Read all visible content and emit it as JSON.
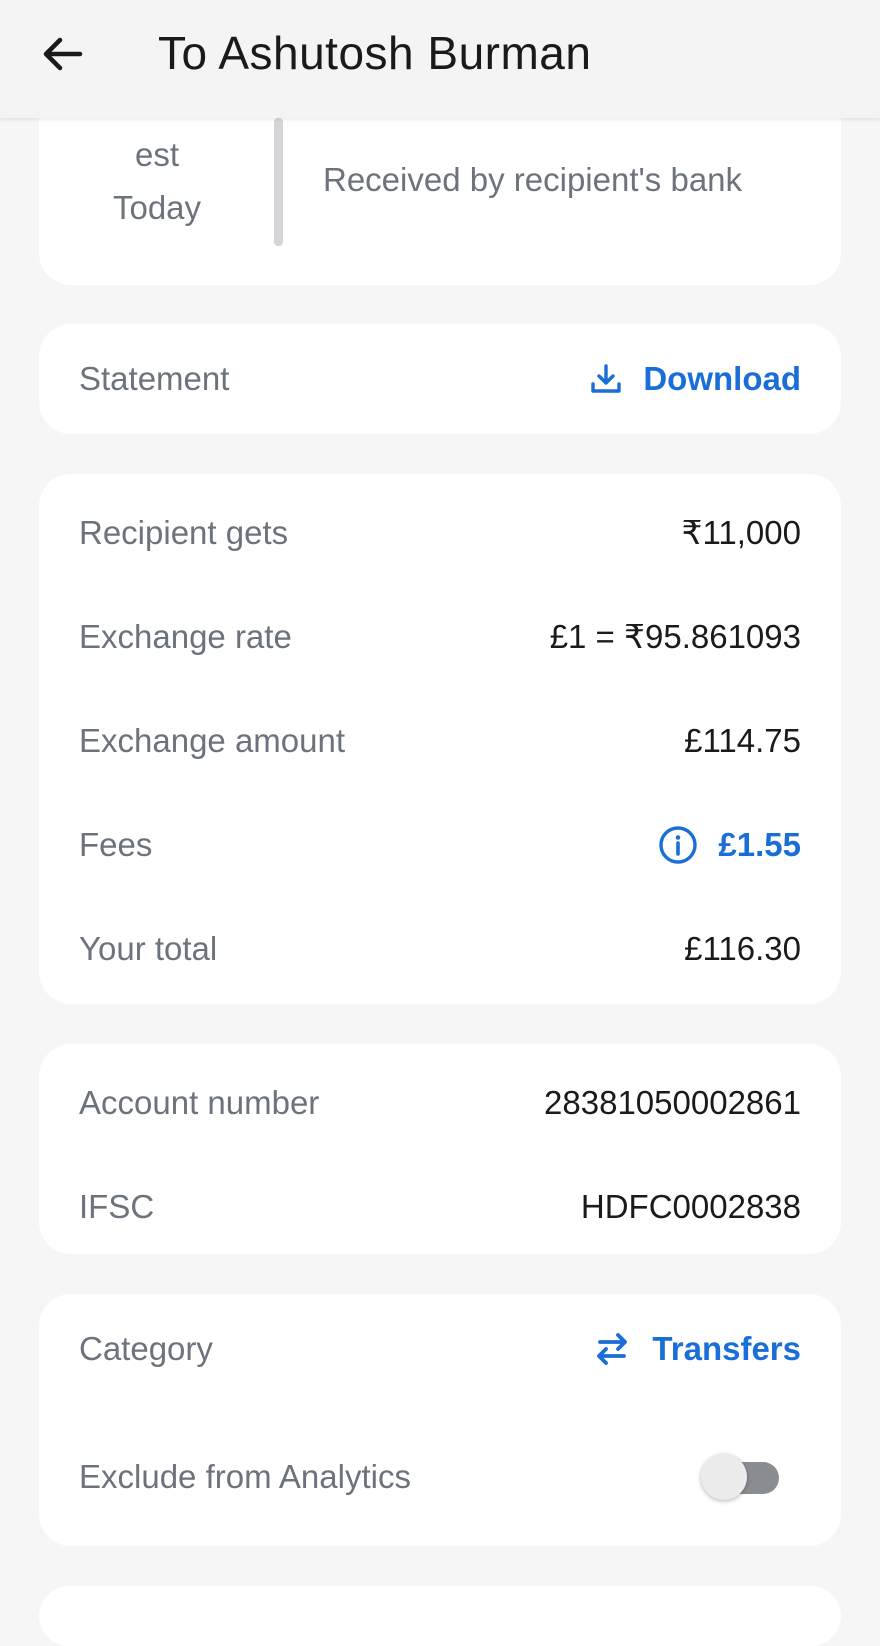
{
  "header": {
    "title": "To Ashutosh Burman"
  },
  "status": {
    "est_label": "est",
    "day_label": "Today",
    "description": "Received by recipient's bank"
  },
  "statement": {
    "label": "Statement",
    "action_label": "Download",
    "action_icon": "download-icon"
  },
  "amounts": {
    "rows": [
      {
        "label": "Recipient gets",
        "value": "₹11,000"
      },
      {
        "label": "Exchange rate",
        "value": "£1 = ₹95.861093"
      },
      {
        "label": "Exchange amount",
        "value": "£114.75"
      },
      {
        "label": "Fees",
        "value": "£1.55",
        "icon": "info-icon"
      },
      {
        "label": "Your total",
        "value": "£116.30"
      }
    ]
  },
  "account": {
    "rows": [
      {
        "label": "Account number",
        "value": "28381050002861"
      },
      {
        "label": "IFSC",
        "value": "HDFC0002838"
      }
    ]
  },
  "category": {
    "label": "Category",
    "value": "Transfers",
    "icon": "swap-arrows-icon",
    "exclude_label": "Exclude from Analytics",
    "exclude_enabled": false
  },
  "colors": {
    "accent": "#1a6ed8",
    "label_gray": "#6c737c",
    "text_dark": "#1a1a1a",
    "background": "#f6f6f6",
    "card": "#ffffff"
  }
}
